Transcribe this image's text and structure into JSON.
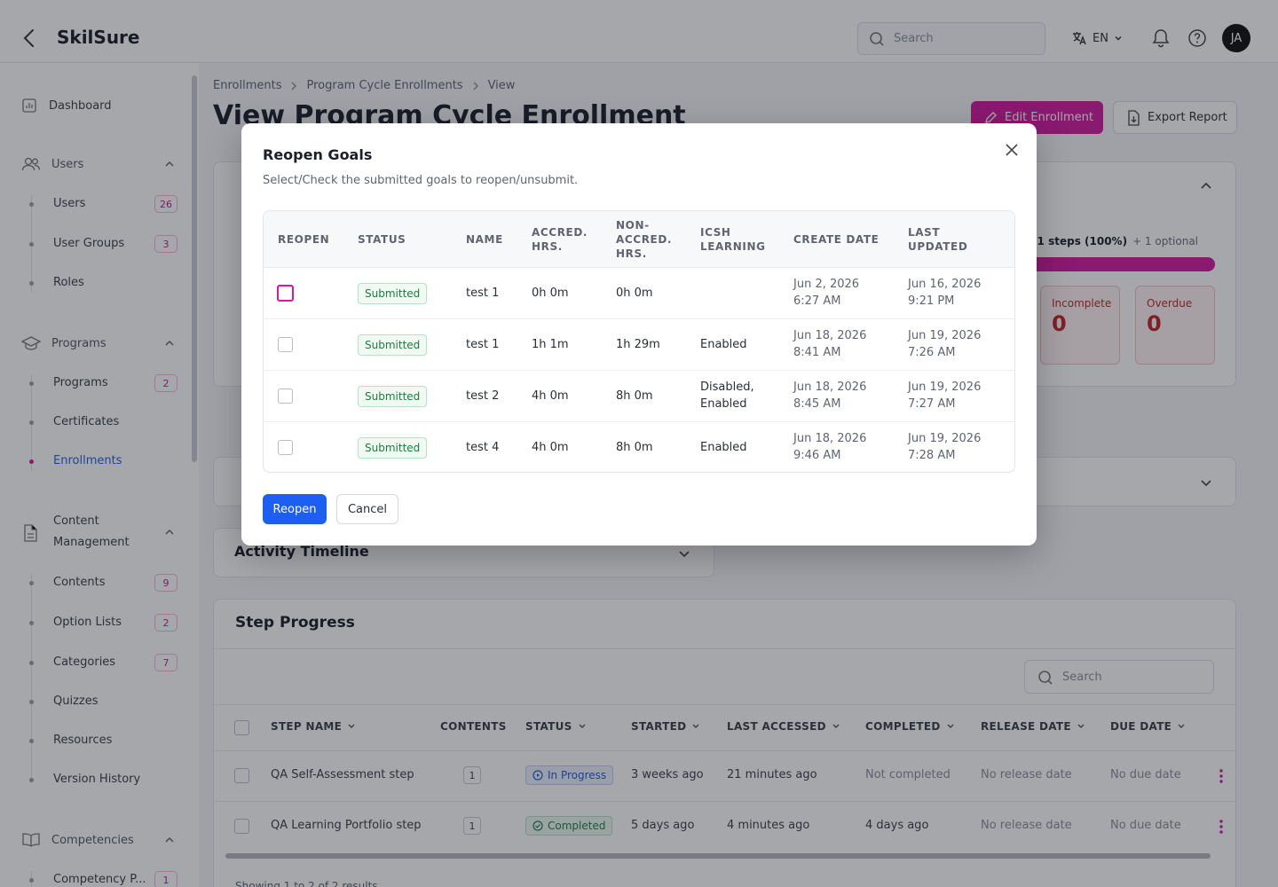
{
  "app": {
    "brand": "SkilSure"
  },
  "header": {
    "search_placeholder": "Search",
    "language": "EN",
    "avatar_initials": "JA"
  },
  "sidebar": {
    "dashboard": "Dashboard",
    "users_section": "Users",
    "users_items": [
      {
        "label": "Users",
        "count": "26"
      },
      {
        "label": "User Groups",
        "count": "3"
      },
      {
        "label": "Roles"
      }
    ],
    "programs_section": "Programs",
    "programs_items": [
      {
        "label": "Programs",
        "count": "2"
      },
      {
        "label": "Certificates"
      },
      {
        "label": "Enrollments"
      }
    ],
    "content_section_line1": "Content",
    "content_section_line2": "Management",
    "content_items": [
      {
        "label": "Contents",
        "count": "9"
      },
      {
        "label": "Option Lists",
        "count": "2"
      },
      {
        "label": "Categories",
        "count": "7"
      },
      {
        "label": "Quizzes"
      },
      {
        "label": "Resources"
      },
      {
        "label": "Version History"
      }
    ],
    "competencies_section": "Competencies",
    "competencies_items": [
      {
        "label": "Competency P...",
        "count": "1"
      }
    ]
  },
  "breadcrumb": [
    "Enrollments",
    "Program Cycle Enrollments",
    "View"
  ],
  "page": {
    "title": "View Program Cycle Enrollment",
    "edit_button": "Edit Enrollment",
    "export_button": "Export Report"
  },
  "summary": {
    "progress_text": "/ 1 steps (100%)",
    "progress_optional": "+ 1 optional",
    "progress_fraction": 1.0,
    "incomplete_label": "Incomplete",
    "incomplete_value": "0",
    "overdue_label": "Overdue",
    "overdue_value": "0"
  },
  "activity_timeline": {
    "title": "Activity Timeline"
  },
  "step_progress": {
    "title": "Step Progress",
    "search_placeholder": "Search",
    "columns": [
      "STEP NAME",
      "CONTENTS",
      "STATUS",
      "STARTED",
      "LAST ACCESSED",
      "COMPLETED",
      "RELEASE DATE",
      "DUE DATE"
    ],
    "rows": [
      {
        "name": "QA Self-Assessment step",
        "contents": "1",
        "status": "In Progress",
        "started": "3 weeks ago",
        "last_accessed": "21 minutes ago",
        "completed": "Not completed",
        "release": "No release date",
        "due": "No due date"
      },
      {
        "name": "QA Learning Portfolio step",
        "contents": "1",
        "status": "Completed",
        "started": "5 days ago",
        "last_accessed": "4 minutes ago",
        "completed": "4 days ago",
        "release": "No release date",
        "due": "No due date"
      }
    ],
    "footer_text": "Showing 1 to 2 of 2 results"
  },
  "modal": {
    "title": "Reopen Goals",
    "subtitle": "Select/Check the submitted goals to reopen/unsubmit.",
    "columns": {
      "reopen": "REOPEN",
      "status": "STATUS",
      "name": "NAME",
      "accred_1": "ACCRED.",
      "accred_2": "HRS.",
      "nonaccred_1": "NON-",
      "nonaccred_2": "ACCRED.",
      "nonaccred_3": "HRS.",
      "icsh_1": "ICSH",
      "icsh_2": "LEARNING",
      "create": "CREATE DATE",
      "updated_1": "LAST",
      "updated_2": "UPDATED"
    },
    "rows": [
      {
        "status": "Submitted",
        "name": "test 1",
        "accred": "0h 0m",
        "nonaccred": "0h 0m",
        "icsh_1": "",
        "icsh_2": "",
        "created_1": "Jun 2, 2026",
        "created_2": "6:27 AM",
        "updated_1": "Jun 16, 2026",
        "updated_2": "9:21 PM"
      },
      {
        "status": "Submitted",
        "name": "test 1",
        "accred": "1h 1m",
        "nonaccred": "1h 29m",
        "icsh_1": "Enabled",
        "icsh_2": "",
        "created_1": "Jun 18, 2026",
        "created_2": "8:41 AM",
        "updated_1": "Jun 19, 2026",
        "updated_2": "7:26 AM"
      },
      {
        "status": "Submitted",
        "name": "test 2",
        "accred": "4h 0m",
        "nonaccred": "8h 0m",
        "icsh_1": "Disabled,",
        "icsh_2": "Enabled",
        "created_1": "Jun 18, 2026",
        "created_2": "8:45 AM",
        "updated_1": "Jun 19, 2026",
        "updated_2": "7:27 AM"
      },
      {
        "status": "Submitted",
        "name": "test 4",
        "accred": "4h 0m",
        "nonaccred": "8h 0m",
        "icsh_1": "Enabled",
        "icsh_2": "",
        "created_1": "Jun 18, 2026",
        "created_2": "9:46 AM",
        "updated_1": "Jun 19, 2026",
        "updated_2": "7:28 AM"
      }
    ],
    "reopen_button": "Reopen",
    "cancel_button": "Cancel"
  }
}
